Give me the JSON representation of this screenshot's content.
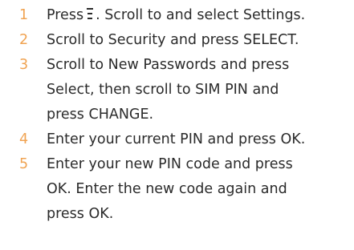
{
  "steps": [
    {
      "num": "1",
      "lines": [
        "Press",
        ". Scroll to and select Settings."
      ],
      "icon": "menu-icon"
    },
    {
      "num": "2",
      "lines": [
        "Scroll to Security and press SELECT."
      ]
    },
    {
      "num": "3",
      "lines": [
        "Scroll to New Passwords and press",
        "Select, then scroll to SIM PIN and",
        "press CHANGE."
      ]
    },
    {
      "num": "4",
      "lines": [
        "Enter your current PIN and press OK."
      ]
    },
    {
      "num": "5",
      "lines": [
        "Enter your new PIN code and press",
        "OK. Enter the new code again and",
        "press OK."
      ]
    }
  ],
  "colors": {
    "number": "#f0a352",
    "text": "#2b2b2b"
  }
}
